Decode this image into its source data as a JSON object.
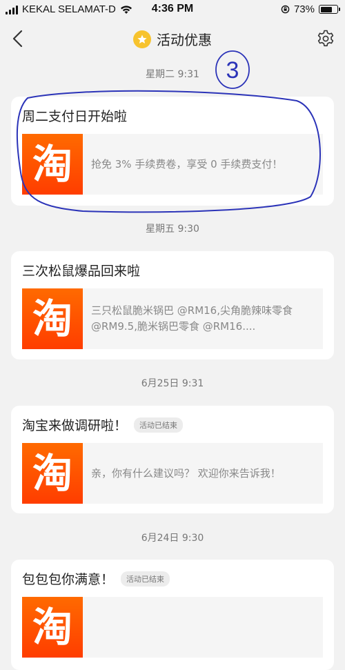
{
  "status_bar": {
    "carrier": "KEKAL SELAMAT-D",
    "time": "4:36 PM",
    "battery": "73%",
    "battery_level": 0.73
  },
  "nav": {
    "title": "活动优惠"
  },
  "messages": [
    {
      "timestamp": "星期二 9:31",
      "title": "周二支付日开始啦",
      "badge": "",
      "logo_char": "淘",
      "body": "抢免 3% 手续费卷，享受 0 手续费支付！"
    },
    {
      "timestamp": "星期五 9:30",
      "title": "三次松鼠爆品回来啦",
      "badge": "",
      "logo_char": "淘",
      "body": "三只松鼠脆米锅巴 @RM16,尖角脆辣味零食 @RM9.5,脆米锅巴零食 @RM16...."
    },
    {
      "timestamp": "6月25日 9:31",
      "title": "淘宝来做调研啦！",
      "badge": "活动已结束",
      "logo_char": "淘",
      "body": "亲，你有什么建议吗？ 欢迎你来告诉我！"
    },
    {
      "timestamp": "6月24日 9:30",
      "title": "包包包你满意！",
      "badge": "活动已结束",
      "logo_char": "淘",
      "body": ""
    }
  ],
  "annotations": {
    "circled_number": "3",
    "ink_color": "#2b33b8"
  },
  "colors": {
    "background": "#f2f2f2",
    "logo_orange": "#ff5000",
    "star_badge": "#f7c32e"
  }
}
